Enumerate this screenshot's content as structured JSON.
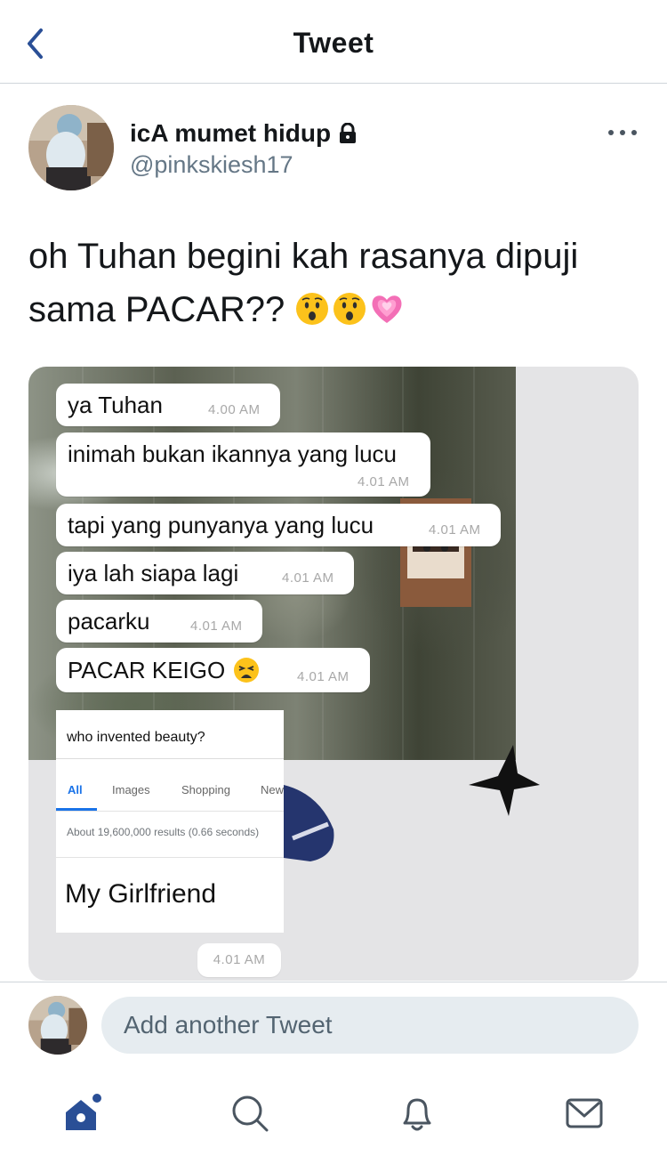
{
  "header": {
    "title": "Tweet"
  },
  "author": {
    "name": "icA mumet hidup",
    "handle": "@pinkskiesh17"
  },
  "tweet": {
    "text": "oh Tuhan begini kah rasanya dipuji sama PACAR??",
    "emojis": [
      "hushed-face",
      "hushed-face",
      "growing-heart"
    ]
  },
  "chat": {
    "messages": [
      {
        "text": "ya Tuhan",
        "time": "4.00 AM"
      },
      {
        "text": "inimah bukan ikannya yang lucu",
        "time": "4.01 AM"
      },
      {
        "text": "tapi yang punyanya yang lucu",
        "time": "4.01 AM"
      },
      {
        "text": "iya lah siapa lagi",
        "time": "4.01 AM"
      },
      {
        "text": "pacarku",
        "time": "4.01 AM"
      },
      {
        "text": "PACAR KEIGO",
        "time": "4.01 AM"
      }
    ],
    "search": {
      "query": "who invented beauty?",
      "tabs": [
        "All",
        "Images",
        "Shopping",
        "New"
      ],
      "active_tab": "All",
      "stats": "About 19,600,000 results (0.66 seconds)",
      "answer": "My Girlfriend"
    },
    "last_time": "4.01 AM"
  },
  "reply": {
    "placeholder": "Add another Tweet"
  },
  "nav": {
    "items": [
      "home-icon",
      "search-icon",
      "notifications-icon",
      "messages-icon"
    ]
  },
  "colors": {
    "accent": "#2a4f96",
    "text": "#14171a",
    "secondary": "#657786",
    "input_bg": "#e6ecf0"
  }
}
